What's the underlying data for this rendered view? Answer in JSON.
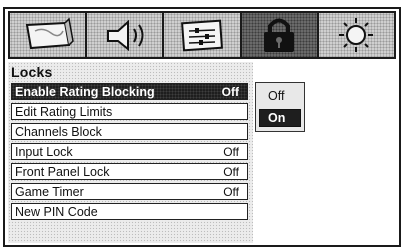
{
  "menu": {
    "title": "Locks",
    "items": [
      {
        "label": "Enable Rating Blocking",
        "value": "Off",
        "selected": true
      },
      {
        "label": "Edit Rating Limits",
        "value": ""
      },
      {
        "label": "Channels Block",
        "value": ""
      },
      {
        "label": "Input Lock",
        "value": "Off"
      },
      {
        "label": "Front Panel Lock",
        "value": "Off"
      },
      {
        "label": "Game Timer",
        "value": "Off"
      },
      {
        "label": "New PIN Code",
        "value": ""
      }
    ]
  },
  "popup": {
    "options": [
      "Off",
      "On"
    ],
    "selected": "On"
  },
  "icons": [
    "picture-icon",
    "audio-icon",
    "setup-icon",
    "lock-icon",
    "settings-icon"
  ],
  "colors": {
    "highlight": "#1e1e1e",
    "frame": "#1a1a1a"
  }
}
